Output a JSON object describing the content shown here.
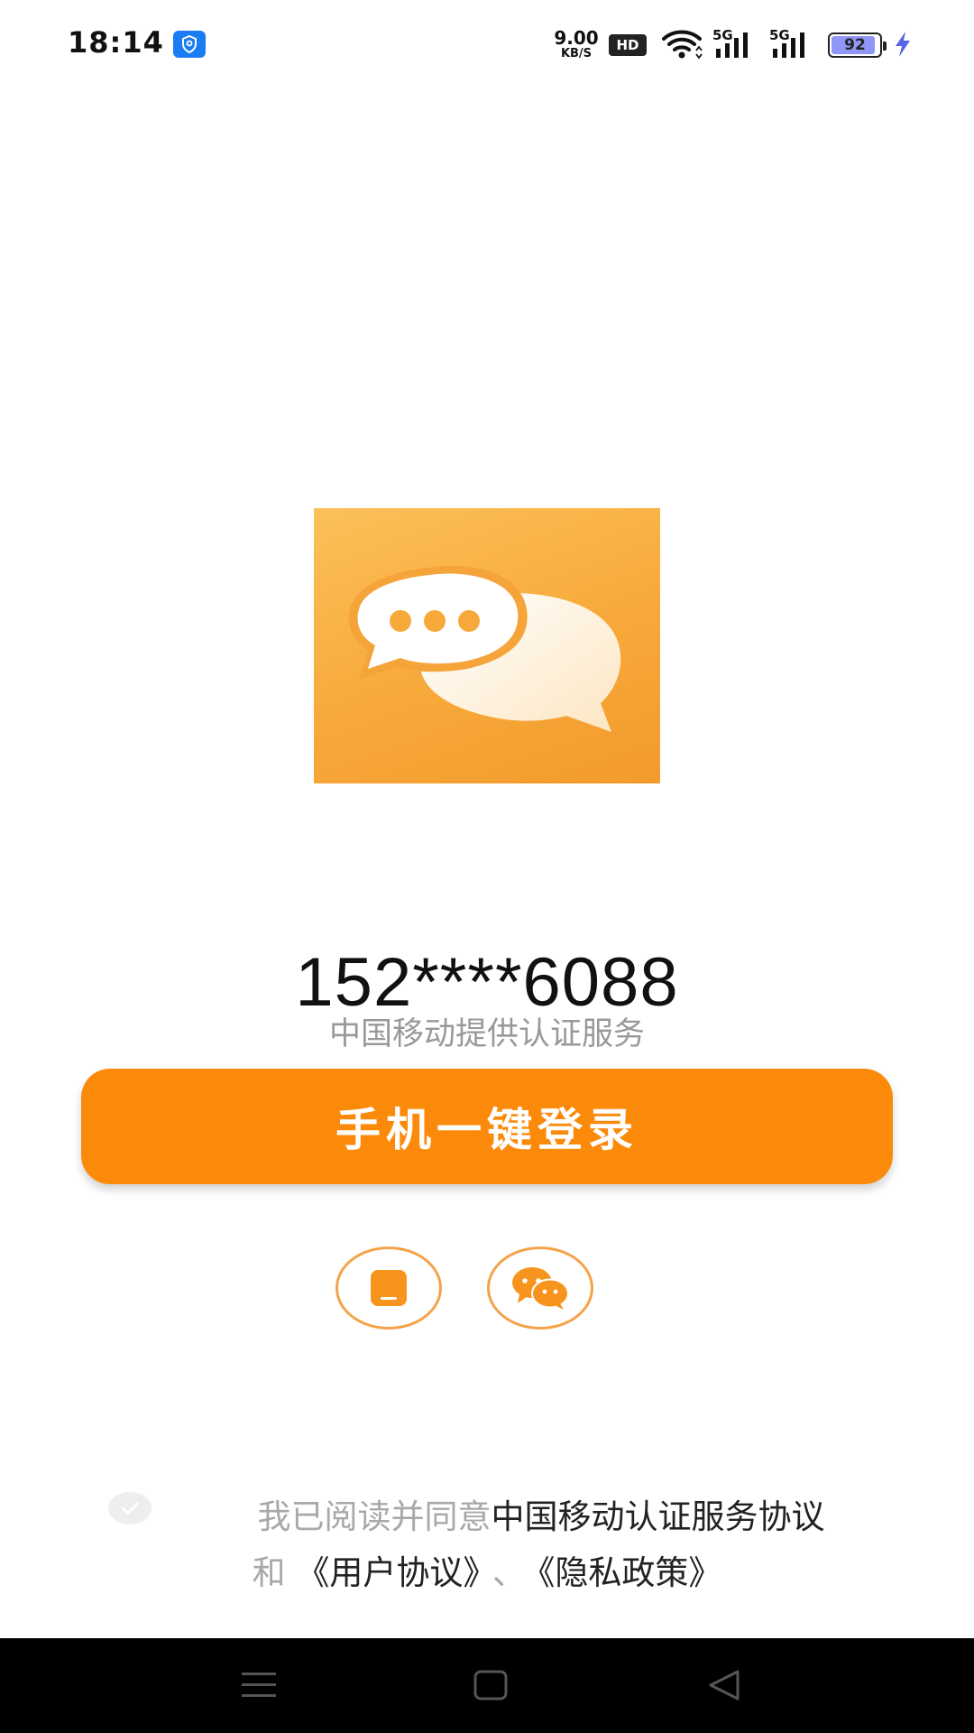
{
  "status_bar": {
    "time": "18:14",
    "net_speed_value": "9.00",
    "net_speed_unit": "KB/S",
    "hd_label": "HD",
    "signal_1_label": "5G",
    "signal_2_label": "5G",
    "battery_level": "92",
    "battery_fraction": 0.92,
    "icons": [
      "shield-icon",
      "wifi-icon",
      "signal-icon",
      "battery-icon",
      "charging-icon"
    ]
  },
  "app": {
    "logo_icon": "chat-bubbles-icon",
    "accent_color": "#fb8a0a"
  },
  "login": {
    "phone_number": "152****6088",
    "carrier_note": "中国移动提供认证服务",
    "one_click_label": "手机一键登录"
  },
  "alt_login": {
    "items": [
      {
        "icon": "phone-icon"
      },
      {
        "icon": "wechat-icon"
      }
    ]
  },
  "agreement": {
    "prefix": "我已阅读并同意",
    "carrier_agreement": "中国移动认证服务协议",
    "and": "和",
    "user_agreement": "《用户协议》",
    "separator": "、",
    "privacy_policy": "《隐私政策》"
  },
  "nav_bar": {
    "icons": [
      "menu-icon",
      "home-icon",
      "back-icon"
    ]
  }
}
